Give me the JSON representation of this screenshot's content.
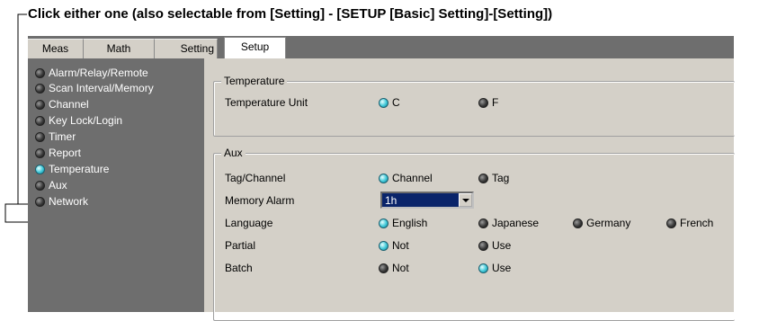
{
  "annotation": "Click either one (also selectable from [Setting] - [SETUP [Basic] Setting]-[Setting])",
  "tabs": [
    {
      "label": "Meas"
    },
    {
      "label": "Math"
    },
    {
      "label": "Setting"
    },
    {
      "label": "Setup",
      "active": true
    }
  ],
  "sidebar": {
    "items": [
      {
        "label": "Alarm/Relay/Remote",
        "selected": false
      },
      {
        "label": "Scan Interval/Memory",
        "selected": false
      },
      {
        "label": "Channel",
        "selected": false
      },
      {
        "label": "Key Lock/Login",
        "selected": false
      },
      {
        "label": "Timer",
        "selected": false
      },
      {
        "label": "Report",
        "selected": false
      },
      {
        "label": "Temperature",
        "selected": true
      },
      {
        "label": "Aux",
        "selected": false
      },
      {
        "label": "Network",
        "selected": false
      }
    ]
  },
  "temperature": {
    "title": "Temperature",
    "unit_label": "Temperature Unit",
    "options": [
      {
        "label": "C",
        "selected": true
      },
      {
        "label": "F",
        "selected": false
      }
    ]
  },
  "aux": {
    "title": "Aux",
    "tag_channel": {
      "label": "Tag/Channel",
      "options": [
        {
          "label": "Channel",
          "selected": true
        },
        {
          "label": "Tag",
          "selected": false
        }
      ]
    },
    "memory_alarm": {
      "label": "Memory Alarm",
      "value": "1h"
    },
    "language": {
      "label": "Language",
      "options": [
        {
          "label": "English",
          "selected": true
        },
        {
          "label": "Japanese",
          "selected": false
        },
        {
          "label": "Germany",
          "selected": false
        },
        {
          "label": "French",
          "selected": false
        }
      ]
    },
    "partial": {
      "label": "Partial",
      "options": [
        {
          "label": "Not",
          "selected": true
        },
        {
          "label": "Use",
          "selected": false
        }
      ]
    },
    "batch": {
      "label": "Batch",
      "options": [
        {
          "label": "Not",
          "selected": false
        },
        {
          "label": "Use",
          "selected": true
        }
      ]
    }
  },
  "colors": {
    "radio_on": "#3ec8d8",
    "radio_off": "#3a3a3a",
    "sidebar_bg": "#6e6e6e",
    "panel_bg": "#d4d0c8",
    "select_bg": "#0a246a"
  }
}
